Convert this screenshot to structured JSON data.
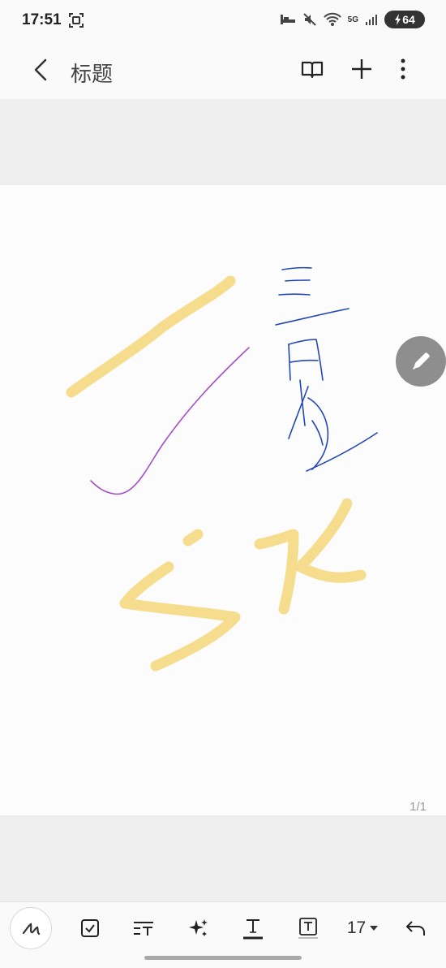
{
  "status_bar": {
    "time": "17:51",
    "network": "5G",
    "battery": "64"
  },
  "app_bar": {
    "title": "标题",
    "icons": [
      "back-arrow-icon",
      "book-icon",
      "plus-icon",
      "more-vertical-icon"
    ]
  },
  "canvas": {
    "page_indicator": "1/1",
    "stroke_colors": {
      "highlighter": "#f6dc8d",
      "purple_pen": "#a44fc7",
      "blue_pen": "#2447b8"
    }
  },
  "toolbar": {
    "font_size": "17",
    "tools": [
      "pen-icon",
      "checkbox-icon",
      "text-format-icon",
      "ai-sparkle-icon",
      "text-underline-icon",
      "text-box-icon",
      "font-size-dropdown",
      "undo-icon"
    ]
  },
  "floating_button": {
    "icon": "pencil-icon"
  }
}
